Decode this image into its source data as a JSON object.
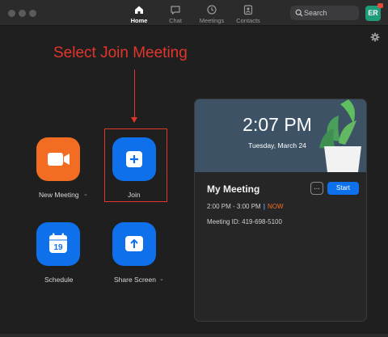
{
  "nav": {
    "tabs": [
      {
        "label": "Home",
        "icon": "home-icon",
        "active": true
      },
      {
        "label": "Chat",
        "icon": "chat-icon",
        "active": false
      },
      {
        "label": "Meetings",
        "icon": "clock-icon",
        "active": false
      },
      {
        "label": "Contacts",
        "icon": "contacts-icon",
        "active": false
      }
    ],
    "search_placeholder": "Search",
    "avatar_initials": "ER"
  },
  "instruction": "Select Join Meeting",
  "actions": [
    {
      "label": "New Meeting",
      "icon": "video-camera-icon",
      "color": "#f26d21",
      "has_dropdown": true
    },
    {
      "label": "Join",
      "icon": "plus-icon",
      "color": "#0e71eb",
      "has_dropdown": false
    },
    {
      "label": "Schedule",
      "icon": "calendar-icon",
      "color": "#0e71eb",
      "calendar_day": "19",
      "has_dropdown": false
    },
    {
      "label": "Share Screen",
      "icon": "share-screen-icon",
      "color": "#0e71eb",
      "has_dropdown": true
    }
  ],
  "meeting_card": {
    "time": "2:07 PM",
    "date": "Tuesday, March 24",
    "title": "My Meeting",
    "more_label": "...",
    "start_label": "Start",
    "time_range": "2:00 PM - 3:00 PM",
    "separator": "|",
    "status": "NOW",
    "meeting_id": "Meeting ID: 419-698-5100"
  },
  "colors": {
    "accent_blue": "#0e71eb",
    "accent_orange": "#f26d21",
    "annotation_red": "#e2352b",
    "background": "#1f1f20"
  }
}
